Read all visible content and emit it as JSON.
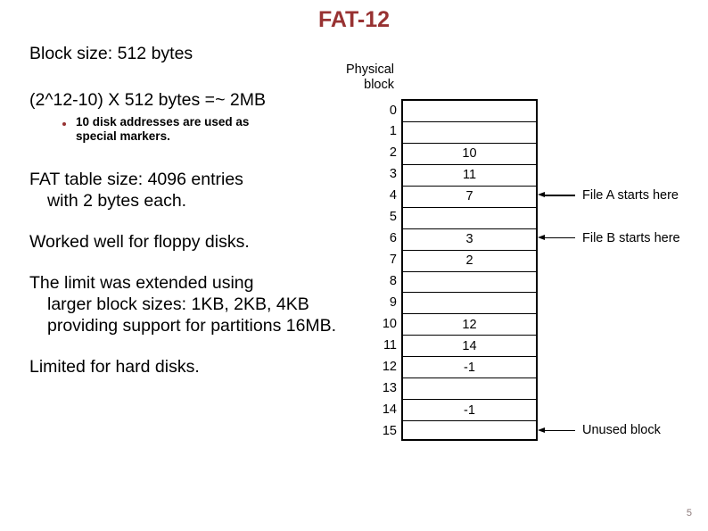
{
  "slide": {
    "title": "FAT-12",
    "title_color": "#983232",
    "page_number": "5"
  },
  "body": {
    "paragraphs": [
      {
        "id": "block-size",
        "line1": "Block size: 512 bytes",
        "line2": ""
      },
      {
        "id": "capacity",
        "line1": "(2^12-10) X 512 bytes =~ 2MB",
        "line2": ""
      },
      {
        "id": "fat-table-size",
        "line1": "FAT table size: 4096 entries",
        "line2": "with 2 bytes each."
      },
      {
        "id": "floppy",
        "line1": "Worked well for floppy disks.",
        "line2": ""
      },
      {
        "id": "limit-extended",
        "line1": "The limit was extended using",
        "line2": "larger block sizes: 1KB, 2KB,",
        "line3": "4KB providing support for",
        "line4": "partitions 16MB."
      },
      {
        "id": "hard-disks",
        "line1": "Limited for hard disks.",
        "line2": ""
      }
    ],
    "sub_bullet": {
      "line1": "10 disk addresses are used as",
      "line2": "special markers.",
      "marker_color": "#963232"
    }
  },
  "diagram": {
    "column_header_line1": "Physical",
    "column_header_line2": "block",
    "rows": [
      {
        "index": "0",
        "value": ""
      },
      {
        "index": "1",
        "value": ""
      },
      {
        "index": "2",
        "value": "10"
      },
      {
        "index": "3",
        "value": "11"
      },
      {
        "index": "4",
        "value": "7"
      },
      {
        "index": "5",
        "value": ""
      },
      {
        "index": "6",
        "value": "3"
      },
      {
        "index": "7",
        "value": "2"
      },
      {
        "index": "8",
        "value": ""
      },
      {
        "index": "9",
        "value": ""
      },
      {
        "index": "10",
        "value": "12"
      },
      {
        "index": "11",
        "value": "14"
      },
      {
        "index": "12",
        "value": "-1"
      },
      {
        "index": "13",
        "value": ""
      },
      {
        "index": "14",
        "value": "-1"
      },
      {
        "index": "15",
        "value": ""
      }
    ],
    "annotations": [
      {
        "row": 4,
        "label": "File A starts here"
      },
      {
        "row": 6,
        "label": "File B starts here"
      },
      {
        "row": 15,
        "label": "Unused block"
      }
    ]
  }
}
